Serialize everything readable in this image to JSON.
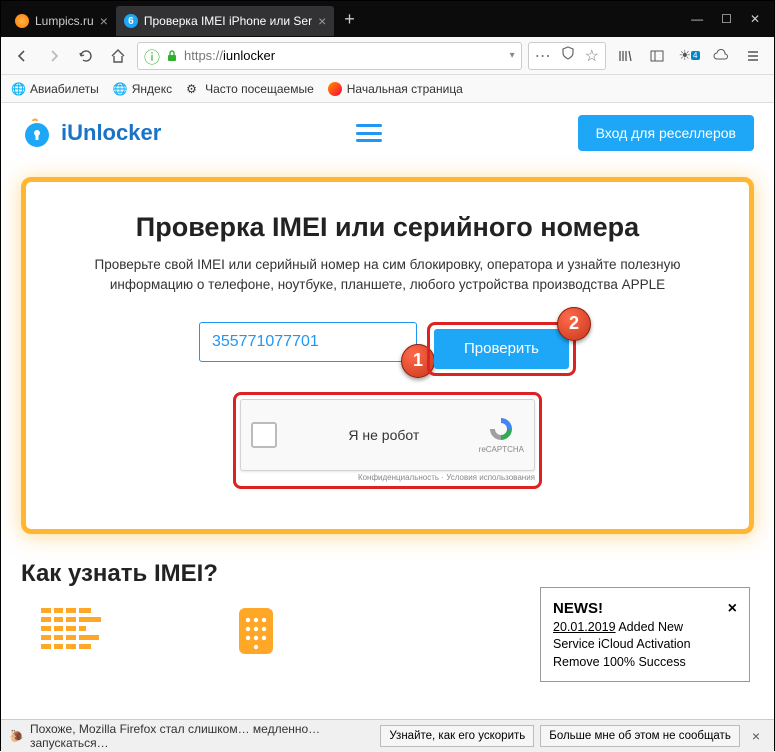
{
  "browser": {
    "tabs": [
      {
        "title": "Lumpics.ru",
        "active": false
      },
      {
        "title": "Проверка IMEI iPhone или Ser",
        "active": true
      }
    ],
    "url_prefix": "https://",
    "url_host": "iunlocker",
    "bookmarks": [
      {
        "label": "Авиабилеты"
      },
      {
        "label": "Яндекс"
      },
      {
        "label": "Часто посещаемые"
      },
      {
        "label": "Начальная страница"
      }
    ]
  },
  "site": {
    "logo_text": "iUnlocker",
    "reseller_button": "Вход для реселлеров",
    "main_title": "Проверка IMEI или серийного номера",
    "main_sub": "Проверьте свой IMEI или серийный номер на сим блокировку, оператора и узнайте полезную информацию о телефоне, ноутбуке, планшете, любого устройства производства APPLE",
    "imei_value": "355771077701",
    "check_button": "Проверить",
    "captcha_label": "Я не робот",
    "captcha_brand": "reCAPTCHA",
    "captcha_terms": "Конфиденциальность · Условия использования",
    "badge1": "1",
    "badge2": "2",
    "section_title": "Как узнать IMEI?"
  },
  "news": {
    "title": "NEWS!",
    "date": "20.01.2019",
    "body": " Added New Service iCloud Activation Remove 100% Success"
  },
  "status": {
    "msg": "Похоже, Mozilla Firefox стал слишком… медленно… запускаться…",
    "btn1": "Узнайте, как его ускорить",
    "btn2": "Больше мне об этом не сообщать"
  }
}
